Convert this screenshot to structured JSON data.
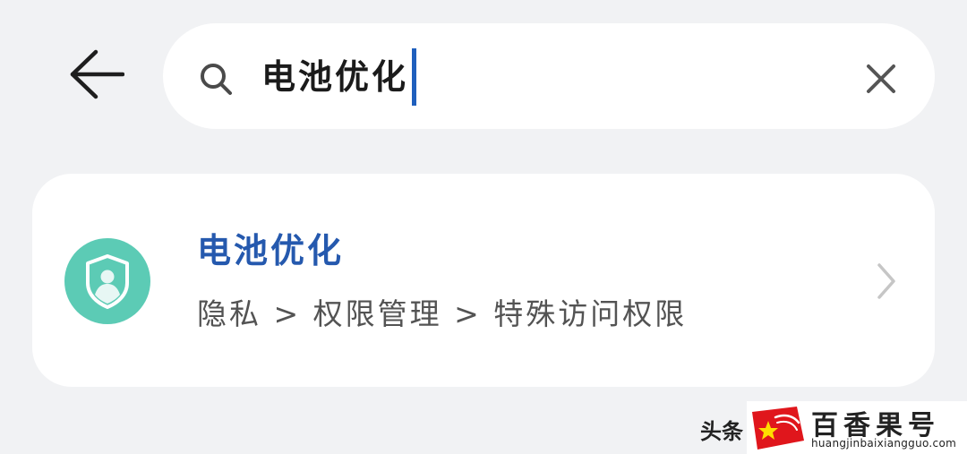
{
  "header": {
    "back_icon": "arrow-left-icon",
    "search": {
      "icon": "search-icon",
      "value": "电池优化",
      "clear_icon": "close-icon"
    }
  },
  "results": [
    {
      "icon": "privacy-shield-user-icon",
      "icon_color": "#5ccbb5",
      "title": "电池优化",
      "title_color": "#2559ae",
      "path": "隐私 > 权限管理 > 特殊访问权限",
      "chevron_icon": "chevron-right-icon"
    }
  ],
  "watermark": {
    "left_text": "头条",
    "brand": "百香果号",
    "domain": "huangjinbaixiangguo.com",
    "logo_icon": "red-logo-star-icon"
  },
  "colors": {
    "background": "#f1f2f4",
    "caret": "#1f5fbd"
  }
}
